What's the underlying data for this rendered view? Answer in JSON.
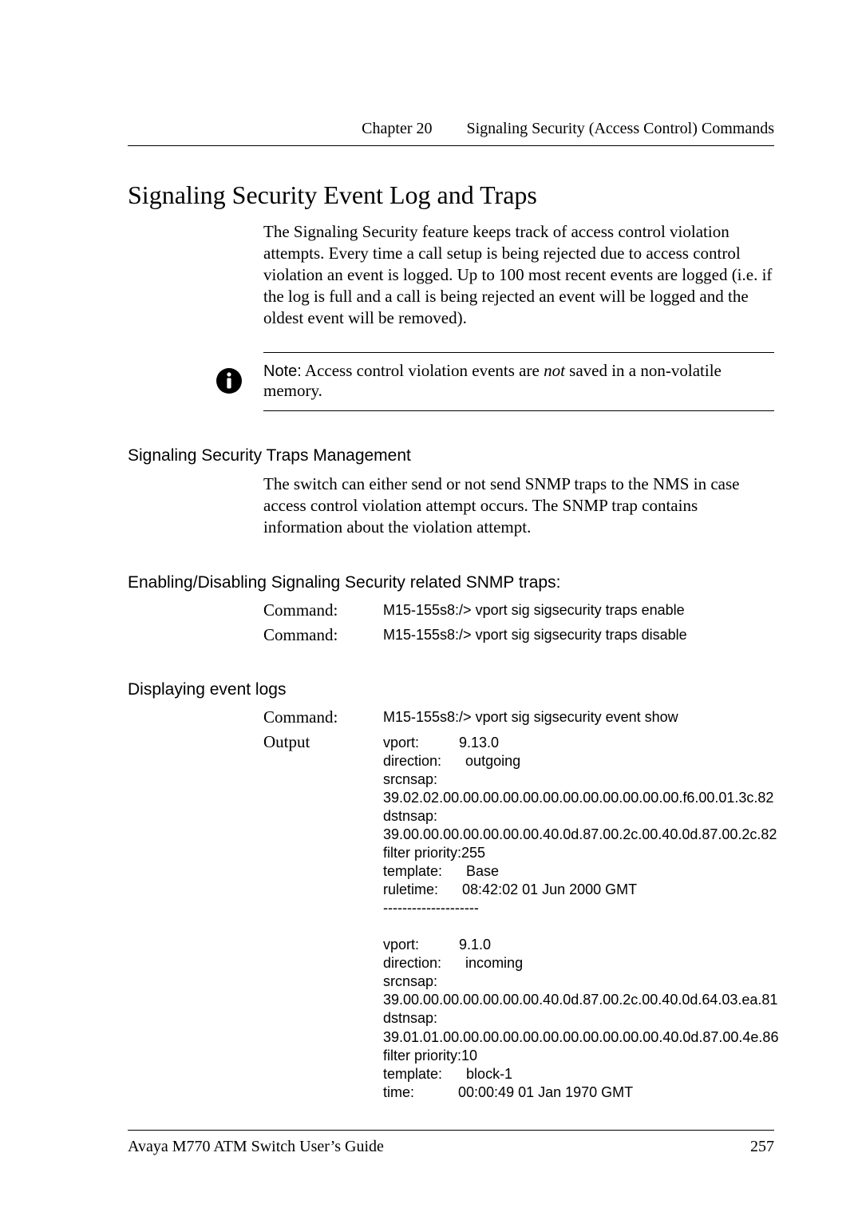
{
  "running_head": {
    "chapter": "Chapter 20",
    "title": "Signaling Security (Access Control) Commands"
  },
  "h1": "Signaling Security Event Log and Traps",
  "intro": "The Signaling Security feature keeps track of access control violation attempts. Every time a call setup is being rejected due to access control violation an event is logged. Up to 100 most recent events are logged (i.e. if the log is full and a call is being rejected an event will be logged and the oldest event will be removed).",
  "note": {
    "label": "Note:",
    "before": " Access control violation events are ",
    "emph": "not",
    "after": " saved in a non-volatile memory."
  },
  "sec1": {
    "heading": "Signaling Security Traps Management",
    "para": "The switch can either send or not send SNMP traps to the NMS in case access control violation attempt occurs. The SNMP trap contains information about the violation attempt."
  },
  "sec2": {
    "heading": "Enabling/Disabling Signaling Security related SNMP traps:",
    "cmds": [
      {
        "label": "Command:",
        "value": "M15-155s8:/> vport sig sigsecurity traps enable"
      },
      {
        "label": "Command:",
        "value": "M15-155s8:/> vport sig sigsecurity traps disable"
      }
    ]
  },
  "sec3": {
    "heading": "Displaying event logs",
    "cmd": {
      "label": "Command:",
      "value": "M15-155s8:/> vport sig sigsecurity event show"
    },
    "output_label": "Output",
    "output": "vport:          9.13.0\ndirection:      outgoing\nsrcnsap:\n39.02.02.00.00.00.00.00.00.00.00.00.00.00.00.f6.00.01.3c.82\ndstnsap:\n39.00.00.00.00.00.00.00.40.0d.87.00.2c.00.40.0d.87.00.2c.82\nfilter priority:255\ntemplate:      Base\nruletime:      08:42:02 01 Jun 2000 GMT\n--------------------\n\nvport:          9.1.0\ndirection:      incoming\nsrcnsap:\n39.00.00.00.00.00.00.00.40.0d.87.00.2c.00.40.0d.64.03.ea.81\ndstnsap:\n39.01.01.00.00.00.00.00.00.00.00.00.00.00.40.0d.87.00.4e.86\nfilter priority:10\ntemplate:      block-1\ntime:           00:00:49 01 Jan 1970 GMT"
  },
  "footer": {
    "left": "Avaya M770 ATM Switch User’s Guide",
    "right": "257"
  }
}
